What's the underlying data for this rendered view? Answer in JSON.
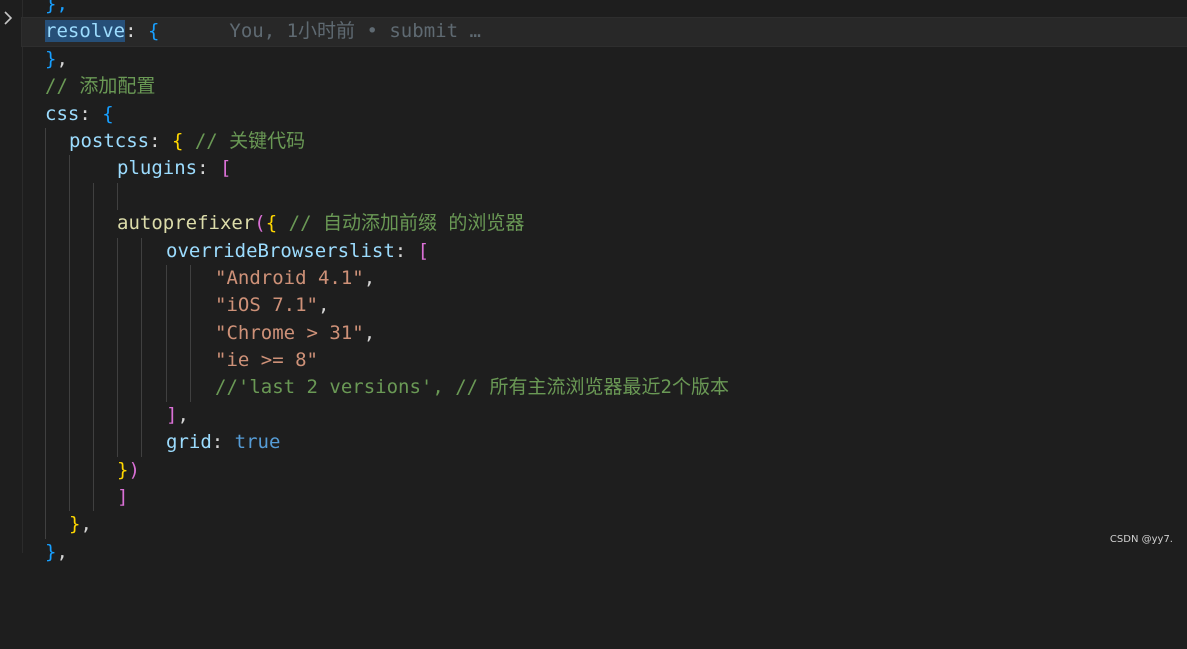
{
  "gutter": {
    "fold_icon": "chevron-right-icon"
  },
  "blame": "You, 1小时前 • submit …",
  "lines": {
    "l0": {
      "t1": "},"
    },
    "l1": {
      "t1": "resolve",
      "t2": ": ",
      "t3": "{"
    },
    "l2": {
      "t1": "}",
      "t2": ","
    },
    "l3": {
      "t1": "// 添加配置"
    },
    "l4": {
      "t1": "css",
      "t2": ": ",
      "t3": "{"
    },
    "l5": {
      "t1": "postcss",
      "t2": ": ",
      "t3": "{",
      "t4": " // 关键代码"
    },
    "l6": {
      "t1": "plugins",
      "t2": ": ",
      "t3": "["
    },
    "l7": {},
    "l8": {
      "t1": "autoprefixer",
      "t2": "(",
      "t3": "{",
      "t4": " // 自动添加前缀 的浏览器"
    },
    "l9": {
      "t1": "overrideBrowserslist",
      "t2": ": ",
      "t3": "["
    },
    "l10": {
      "t1": "\"Android 4.1\"",
      "t2": ","
    },
    "l11": {
      "t1": "\"iOS 7.1\"",
      "t2": ","
    },
    "l12": {
      "t1": "\"Chrome > 31\"",
      "t2": ","
    },
    "l13": {
      "t1": "\"ie >= 8\""
    },
    "l14": {
      "t1": "//'last 2 versions', // 所有主流浏览器最近2个版本"
    },
    "l15": {
      "t1": "]",
      "t2": ","
    },
    "l16": {
      "t1": "grid",
      "t2": ": ",
      "t3": "true"
    },
    "l17": {
      "t1": "}",
      "t2": ")"
    },
    "l18": {
      "t1": "]"
    },
    "l19": {
      "t1": "}",
      "t2": ","
    },
    "l20": {
      "t1": "}",
      "t2": ","
    }
  },
  "watermark": "CSDN @yy7."
}
